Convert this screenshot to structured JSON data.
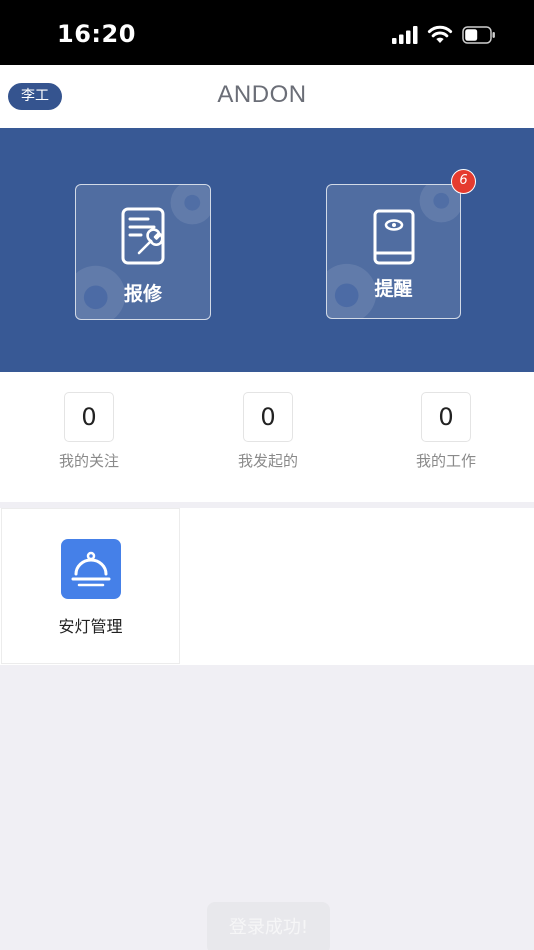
{
  "status_bar": {
    "time": "16:20",
    "icons": [
      "cellular-signal-icon",
      "wifi-icon",
      "battery-icon"
    ]
  },
  "header": {
    "user_chip": "李工",
    "title": "ANDON"
  },
  "banner": {
    "background": "#385995",
    "tiles": [
      {
        "label": "报修",
        "icon": "repair-document-wrench-icon"
      },
      {
        "label": "提醒",
        "icon": "reminder-book-icon",
        "badge": "6"
      }
    ]
  },
  "stats": [
    {
      "value": "0",
      "label": "我的关注"
    },
    {
      "value": "0",
      "label": "我发起的"
    },
    {
      "value": "0",
      "label": "我的工作"
    }
  ],
  "modules": [
    {
      "label": "安灯管理",
      "icon": "service-bell-icon",
      "color": "#4580e8"
    }
  ],
  "toast": "登录成功!"
}
